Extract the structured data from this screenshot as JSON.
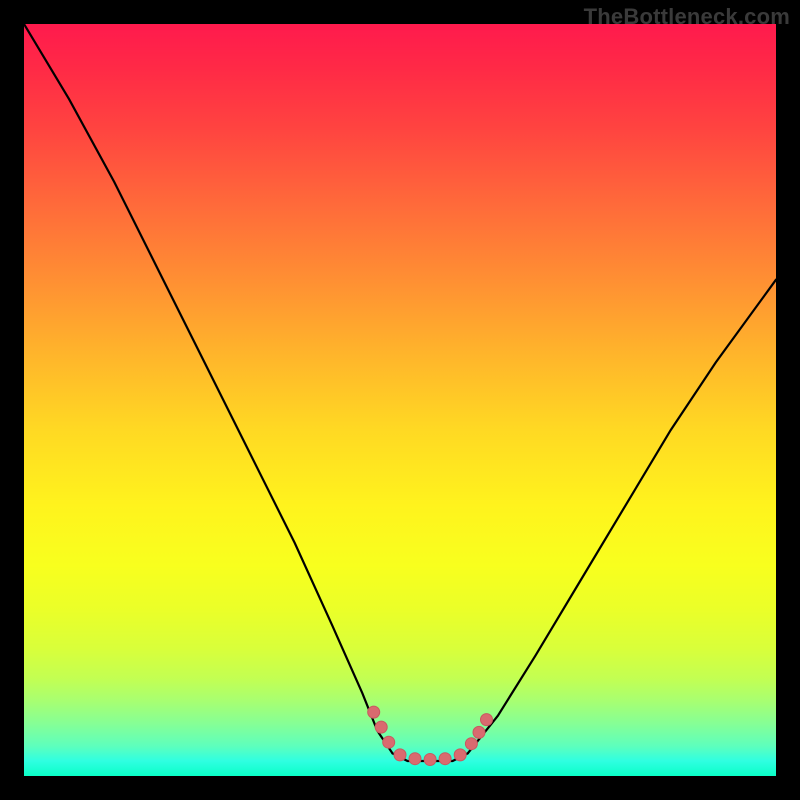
{
  "watermark": "TheBottleneck.com",
  "colors": {
    "curve": "#000000",
    "marker_fill": "#d96a6f",
    "marker_stroke": "#c85a60"
  },
  "chart_data": {
    "type": "line",
    "title": "",
    "xlabel": "",
    "ylabel": "",
    "xlim": [
      0,
      100
    ],
    "ylim": [
      0,
      100
    ],
    "grid": false,
    "legend": false,
    "background": "rainbow-gradient-vertical",
    "series": [
      {
        "name": "left-curve",
        "x": [
          0,
          6,
          12,
          18,
          24,
          30,
          36,
          41,
          45,
          47,
          49
        ],
        "y": [
          100,
          90,
          79,
          67,
          55,
          43,
          31,
          20,
          11,
          6,
          3
        ]
      },
      {
        "name": "valley-floor",
        "x": [
          49,
          51,
          53,
          55,
          57,
          59
        ],
        "y": [
          3,
          2,
          2,
          2,
          2,
          3
        ]
      },
      {
        "name": "right-curve",
        "x": [
          59,
          63,
          68,
          74,
          80,
          86,
          92,
          100
        ],
        "y": [
          3,
          8,
          16,
          26,
          36,
          46,
          55,
          66
        ]
      }
    ],
    "markers": [
      {
        "x": 46.5,
        "y": 8.5
      },
      {
        "x": 47.5,
        "y": 6.5
      },
      {
        "x": 48.5,
        "y": 4.5
      },
      {
        "x": 50.0,
        "y": 2.8
      },
      {
        "x": 52.0,
        "y": 2.3
      },
      {
        "x": 54.0,
        "y": 2.2
      },
      {
        "x": 56.0,
        "y": 2.3
      },
      {
        "x": 58.0,
        "y": 2.8
      },
      {
        "x": 59.5,
        "y": 4.3
      },
      {
        "x": 60.5,
        "y": 5.8
      },
      {
        "x": 61.5,
        "y": 7.5
      }
    ]
  }
}
